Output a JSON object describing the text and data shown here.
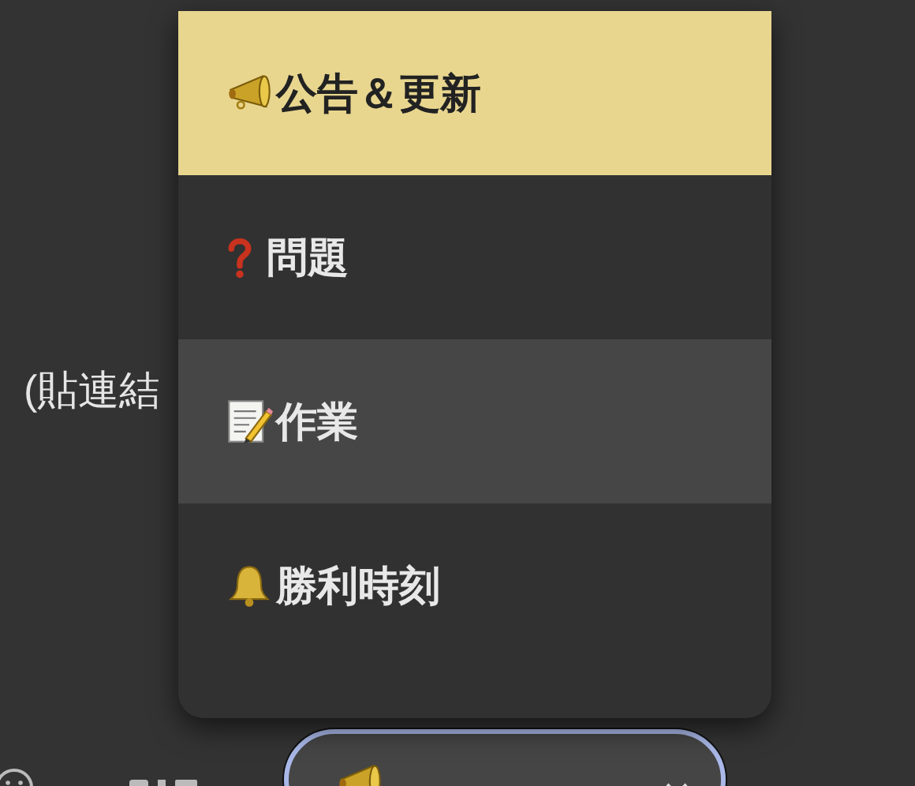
{
  "composer": {
    "text": "(貼連結"
  },
  "menu": {
    "items": [
      {
        "label": "公告＆更新",
        "selected": true,
        "hovered": false
      },
      {
        "label": "問題",
        "selected": false,
        "hovered": false
      },
      {
        "label": "作業",
        "selected": false,
        "hovered": true
      },
      {
        "label": "勝利時刻",
        "selected": false,
        "hovered": false
      }
    ]
  }
}
